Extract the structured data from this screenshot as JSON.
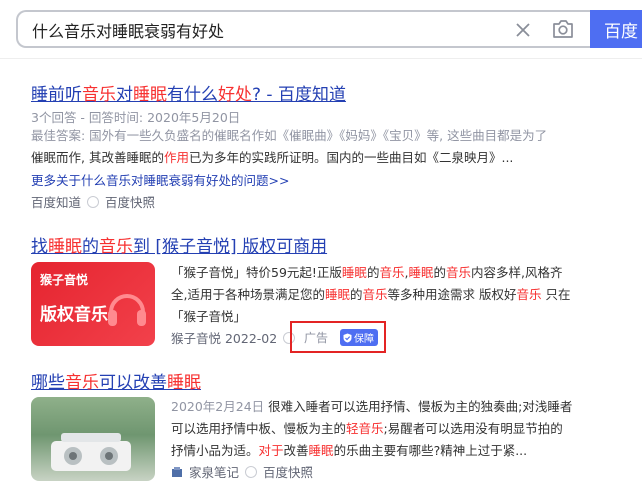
{
  "search": {
    "query": "什么音乐对睡眠衰弱有好处",
    "button_label": "百度"
  },
  "results": [
    {
      "title_pre": "睡前听",
      "title_hl1": "音乐",
      "title_mid": "对",
      "title_hl2": "睡眠",
      "title_post": "有什么",
      "title_hl3": "好处",
      "title_end": "? - 百度知道",
      "meta": "3个回答 - 回答时间: 2020年5月20日",
      "snippet_line1": "最佳答案: 国外有一些久负盛名的催眠名作如《催眠曲》《妈妈》《宝贝》等, 这些曲目都是为了",
      "snippet_line2_pre": "催眠而作, 其改善睡眠的",
      "snippet_line2_hl": "作用",
      "snippet_line2_post": "已为多年的实践所证明。国内的一些曲目如《二泉映月》...",
      "more": "更多关于什么音乐对睡眠衰弱有好处的问题>>",
      "source": "百度知道",
      "snapshot": "百度快照"
    },
    {
      "title_pre": "找",
      "title_hl1": "睡眠",
      "title_mid": "的",
      "title_hl2": "音乐",
      "title_post": "到 [猴子音悦] 版权可商用",
      "thumb_brand": "猴子音悦",
      "thumb_tag": "版权音乐",
      "snippet_line1_pre": "「猴子音悦」特价59元起!正版",
      "snippet_line1_hl1": "睡眠",
      "snippet_line1_mid1": "的",
      "snippet_line1_hl2": "音乐",
      "snippet_line1_mid2": ",",
      "snippet_line1_hl3": "睡眠",
      "snippet_line1_mid3": "的",
      "snippet_line1_hl4": "音乐",
      "snippet_line1_post": "内容多样,风格齐",
      "snippet_line2_pre": "全,适用于各种场景满足您的",
      "snippet_line2_hl1": "睡眠",
      "snippet_line2_mid": "的",
      "snippet_line2_hl2": "音乐",
      "snippet_line2_post": "等多种用途需求 版权好",
      "snippet_line2_hl3": "音乐",
      "snippet_line2_end": " 只在",
      "snippet_line3": "「猴子音悦」",
      "source": "猴子音悦 2022-02",
      "ad": "广告",
      "guarantee": "保障"
    },
    {
      "title_pre": "哪些",
      "title_hl1": "音乐",
      "title_mid": "可以改善",
      "title_hl2": "睡眠",
      "snippet_line1_date": "2020年2月24日",
      "snippet_line1": " 很难入睡者可以选用抒情、慢板为主的独奏曲;对浅睡者",
      "snippet_line2_pre": "可以选用抒情中板、慢板为主的",
      "snippet_line2_hl": "轻音乐",
      "snippet_line2_post": ";易醒者可以选用没有明显节拍的",
      "snippet_line3_pre": "抒情小品为适。",
      "snippet_line3_hl1": "对于",
      "snippet_line3_mid": "改善",
      "snippet_line3_hl2": "睡眠",
      "snippet_line3_post": "的乐曲主要有哪些?精神上过于紧...",
      "source": "家泉笔记",
      "snapshot": "百度快照"
    }
  ],
  "colors": {
    "accent": "#4e6ef2",
    "link": "#2440b3",
    "highlight": "#f73131",
    "ad_border": "#e32424"
  },
  "icons": [
    "clear-icon",
    "camera-icon",
    "snapshot-icon",
    "guarantee-shield-icon",
    "headphones-icon",
    "source-logo-icon"
  ]
}
